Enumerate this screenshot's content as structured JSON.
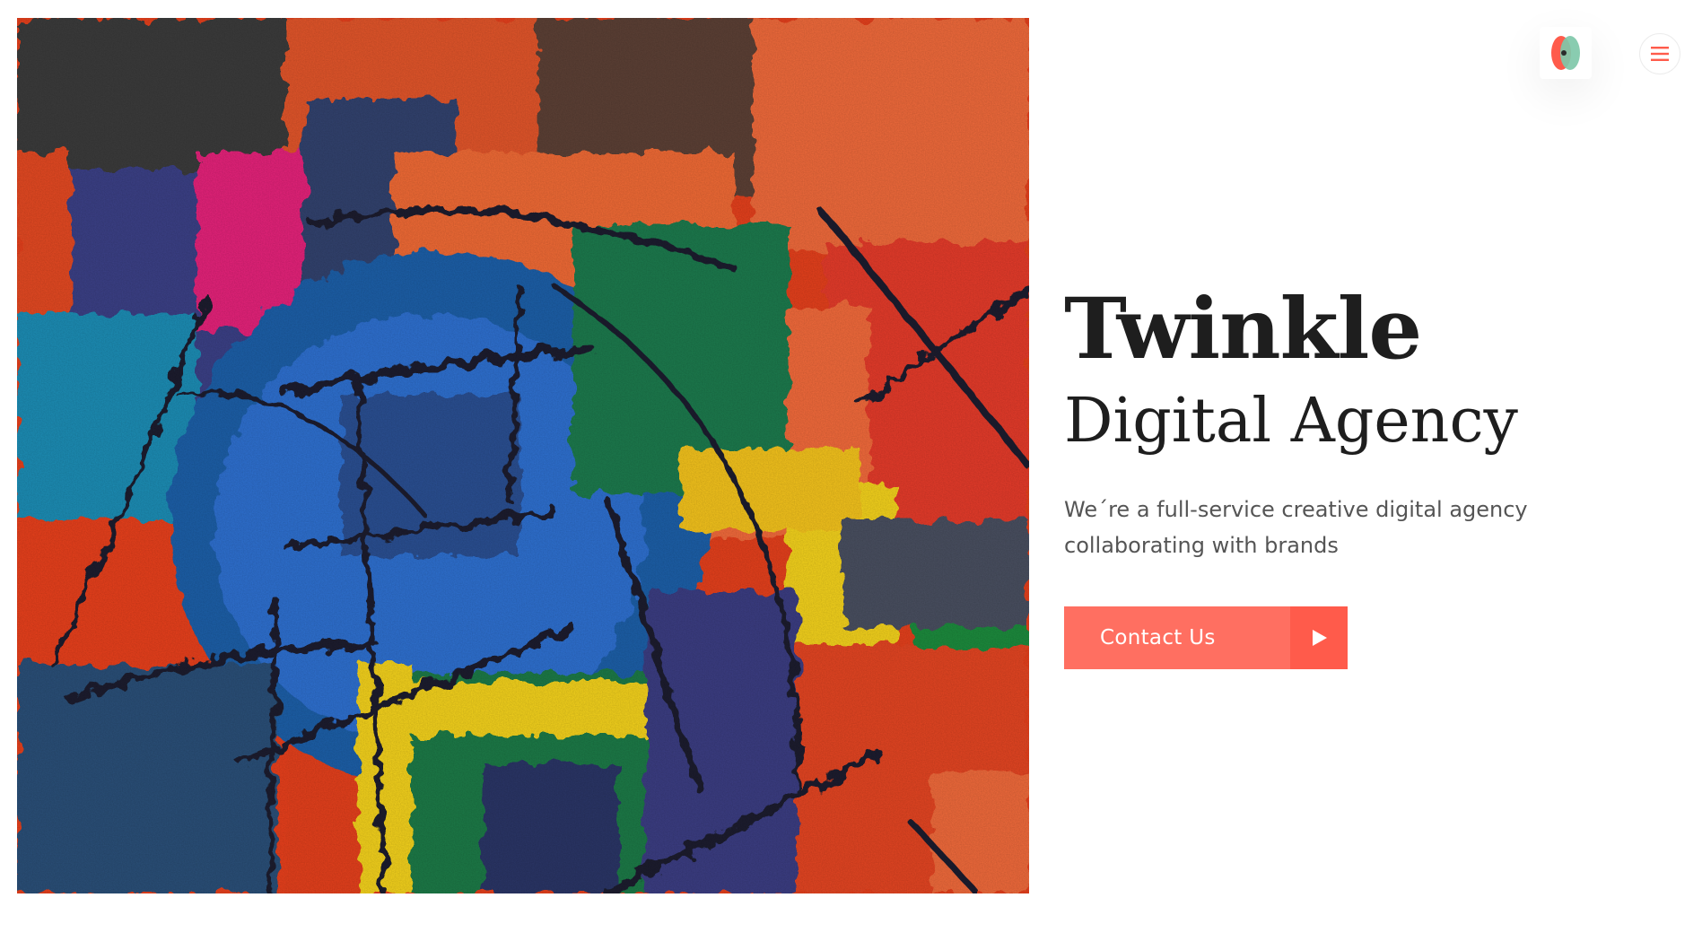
{
  "header": {
    "logo_icon": "twinkle-logo-icon",
    "menu_icon": "hamburger-menu-icon"
  },
  "hero": {
    "image_alt": "abstract-painting-image",
    "title": "Twinkle",
    "subtitle": "Digital Agency",
    "description": "We´re a full-service creative digital agency collaborating with brands",
    "cta": {
      "label": "Contact Us",
      "icon": "play-arrow-icon"
    }
  },
  "colors": {
    "accent": "#ff6f61",
    "accent_dark": "#ff5b4b",
    "heading": "#1e1e1e",
    "body_text": "#555555",
    "logo_red": "#ff5b4b",
    "logo_teal": "#7fc8a9"
  }
}
